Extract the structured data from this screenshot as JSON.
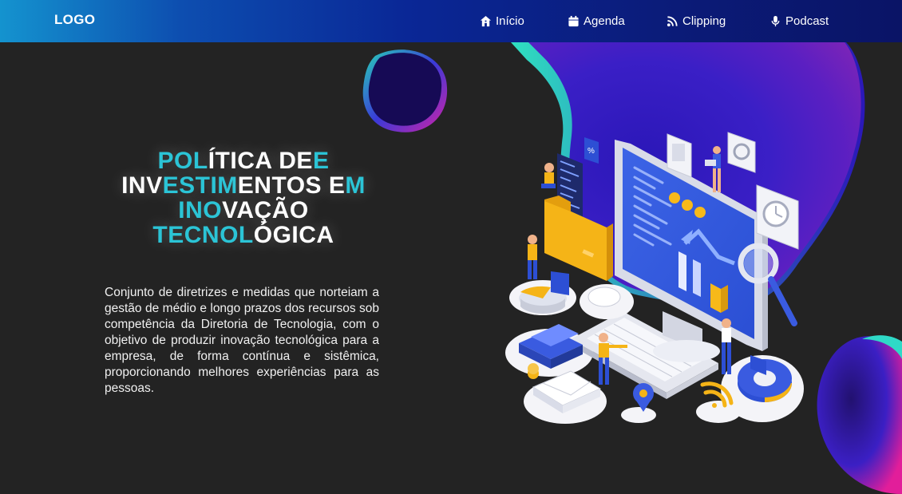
{
  "header": {
    "logo": "LOGO",
    "nav": [
      {
        "label": "Início",
        "icon": "home-icon"
      },
      {
        "label": "Agenda",
        "icon": "calendar-icon"
      },
      {
        "label": "Clipping",
        "icon": "rss-icon"
      },
      {
        "label": "Podcast",
        "icon": "microphone-icon"
      }
    ]
  },
  "hero": {
    "title_lines": [
      [
        {
          "t": "POL",
          "c": 1
        },
        {
          "t": "ÍTICA DE",
          "c": 0
        },
        {
          "t": "E",
          "c": 1
        }
      ],
      [
        {
          "t": "INV",
          "c": 0
        },
        {
          "t": "ESTIM",
          "c": 1
        },
        {
          "t": "ENTOS E",
          "c": 0
        },
        {
          "t": "M",
          "c": 1
        }
      ],
      [
        {
          "t": "INO",
          "c": 1
        },
        {
          "t": "VAÇÃO",
          "c": 0
        }
      ],
      [
        {
          "t": "TECNOL",
          "c": 1
        },
        {
          "t": "ÓGICA",
          "c": 0
        }
      ]
    ],
    "description": "Conjunto de diretrizes e medidas que norteiam a gestão de médio e longo prazos dos recursos sob competência da Diretoria de Tecnologia, com o objetivo de produzir inovação tecnológica para a empresa, de forma contínua e sistêmica, proporcionando melhores experiências para as pessoas."
  },
  "colors": {
    "accent": "#2bc4d6",
    "background": "#232323",
    "header_start": "#1493cf",
    "header_end": "#0a1466"
  }
}
